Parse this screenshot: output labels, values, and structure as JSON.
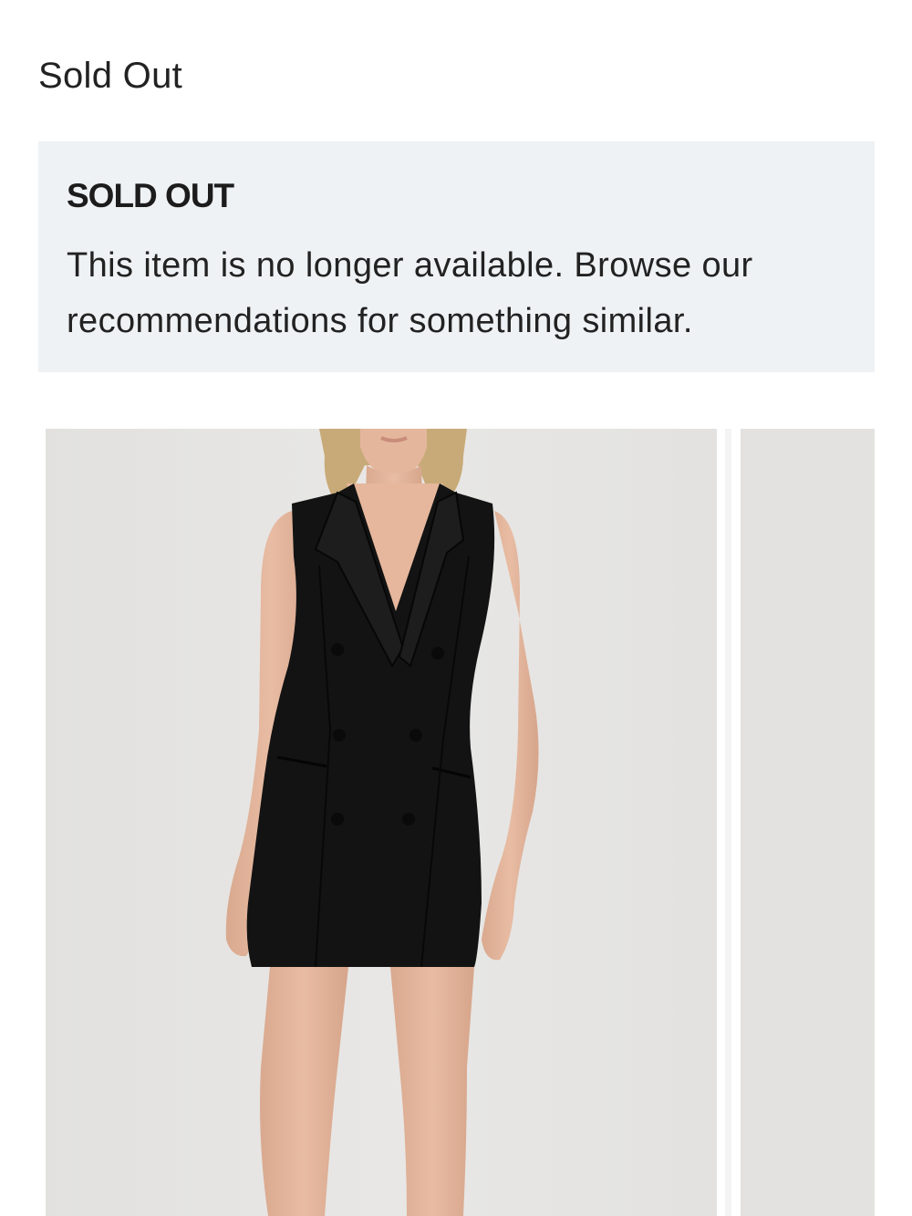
{
  "status": {
    "label": "Sold Out"
  },
  "notice": {
    "title": "SOLD OUT",
    "message": "This item is no longer available. Browse our recommendations for something similar."
  },
  "carousel": {
    "items": [
      {
        "alt": "Black sleeveless double-breasted blazer mini dress"
      },
      {
        "alt": "Next product image"
      }
    ]
  },
  "colors": {
    "notice_bg": "#eff2f4",
    "photo_bg": "#e4e3e1",
    "dress": "#131313"
  }
}
